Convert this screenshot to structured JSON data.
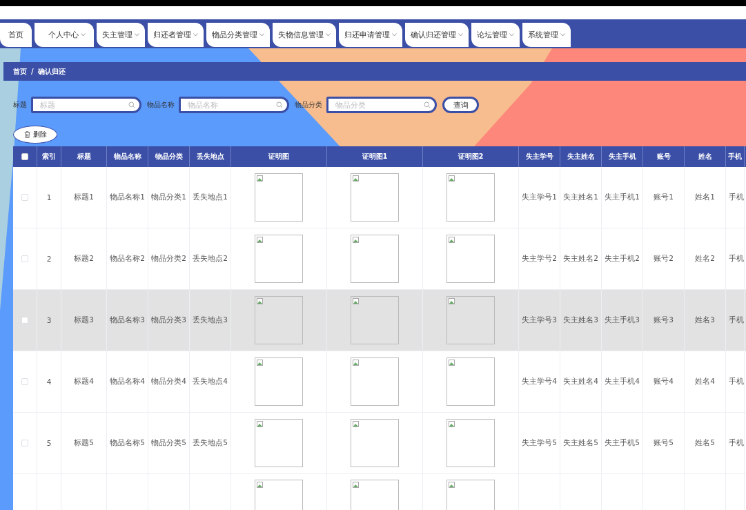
{
  "nav": {
    "items": [
      {
        "label": "首页",
        "has_menu": false
      },
      {
        "label": "个人中心",
        "has_menu": true
      },
      {
        "label": "失主管理",
        "has_menu": true
      },
      {
        "label": "归还者管理",
        "has_menu": true
      },
      {
        "label": "物品分类管理",
        "has_menu": true
      },
      {
        "label": "失物信息管理",
        "has_menu": true
      },
      {
        "label": "归还申请管理",
        "has_menu": true
      },
      {
        "label": "确认归还管理",
        "has_menu": true
      },
      {
        "label": "论坛管理",
        "has_menu": true
      },
      {
        "label": "系统管理",
        "has_menu": true
      }
    ]
  },
  "breadcrumb": {
    "items": [
      "首页",
      "确认归还"
    ],
    "separator": "/"
  },
  "filters": [
    {
      "label": "标题",
      "placeholder": "标题"
    },
    {
      "label": "物品名称",
      "placeholder": "物品名称"
    },
    {
      "label": "物品分类",
      "placeholder": "物品分类"
    }
  ],
  "search_button": "查询",
  "delete_button": "删除",
  "table": {
    "header_checkbox": {
      "checked": false
    },
    "columns": [
      {
        "label": "索引",
        "kind": "index"
      },
      {
        "label": "标题",
        "kind": "wide"
      },
      {
        "label": "物品名称",
        "kind": "text"
      },
      {
        "label": "物品分类",
        "kind": "text"
      },
      {
        "label": "丢失地点",
        "kind": "text"
      },
      {
        "label": "证明图",
        "kind": "image"
      },
      {
        "label": "证明图1",
        "kind": "image"
      },
      {
        "label": "证明图2",
        "kind": "image"
      },
      {
        "label": "失主学号",
        "kind": "text"
      },
      {
        "label": "失主姓名",
        "kind": "text"
      },
      {
        "label": "失主手机",
        "kind": "text"
      },
      {
        "label": "账号",
        "kind": "text"
      },
      {
        "label": "姓名",
        "kind": "text"
      },
      {
        "label": "手机",
        "kind": "cut"
      }
    ],
    "rows": [
      {
        "checked": false,
        "hovered": false,
        "values": [
          "1",
          "标题1",
          "物品名称1",
          "物品分类1",
          "丢失地点1",
          "失主学号1",
          "失主姓名1",
          "失主手机1",
          "账号1",
          "姓名1",
          "手机"
        ]
      },
      {
        "checked": false,
        "hovered": false,
        "values": [
          "2",
          "标题2",
          "物品名称2",
          "物品分类2",
          "丢失地点2",
          "失主学号2",
          "失主姓名2",
          "失主手机2",
          "账号2",
          "姓名2",
          "手机"
        ]
      },
      {
        "checked": false,
        "hovered": true,
        "values": [
          "3",
          "标题3",
          "物品名称3",
          "物品分类3",
          "丢失地点3",
          "失主学号3",
          "失主姓名3",
          "失主手机3",
          "账号3",
          "姓名3",
          "手机"
        ]
      },
      {
        "checked": false,
        "hovered": false,
        "values": [
          "4",
          "标题4",
          "物品名称4",
          "物品分类4",
          "丢失地点4",
          "失主学号4",
          "失主姓名4",
          "失主手机4",
          "账号4",
          "姓名4",
          "手机"
        ]
      },
      {
        "checked": false,
        "hovered": false,
        "values": [
          "5",
          "标题5",
          "物品名称5",
          "物品分类5",
          "丢失地点5",
          "失主学号5",
          "失主姓名5",
          "失主手机5",
          "账号5",
          "姓名5",
          "手机"
        ]
      }
    ]
  }
}
